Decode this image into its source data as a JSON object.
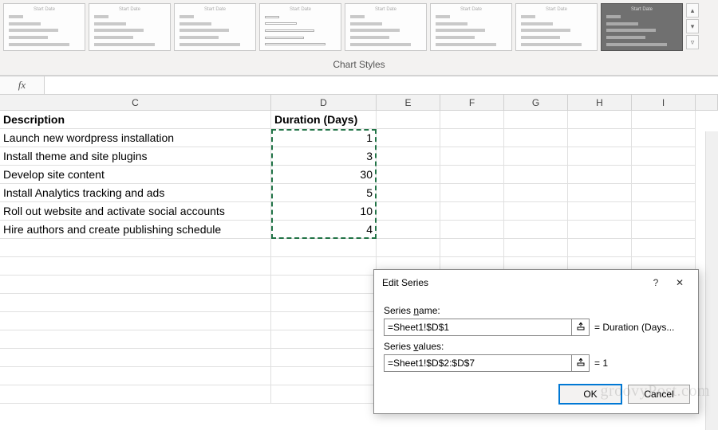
{
  "ribbon": {
    "label": "Chart Styles",
    "thumb_title": "Start Date"
  },
  "formula_bar": {
    "fx": "fx",
    "value": ""
  },
  "columns": [
    "C",
    "D",
    "E",
    "F",
    "G",
    "H",
    "I"
  ],
  "headers": {
    "c": "Description",
    "d": "Duration (Days)"
  },
  "rows": [
    {
      "desc": "Launch new wordpress installation",
      "dur": "1"
    },
    {
      "desc": "Install theme and site plugins",
      "dur": "3"
    },
    {
      "desc": "Develop site content",
      "dur": "30"
    },
    {
      "desc": "Install Analytics tracking and ads",
      "dur": "5"
    },
    {
      "desc": "Roll out website and activate social accounts",
      "dur": "10"
    },
    {
      "desc": "Hire authors and create publishing schedule",
      "dur": "4"
    }
  ],
  "dialog": {
    "title": "Edit Series",
    "name_label_pre": "Series ",
    "name_label_u": "n",
    "name_label_post": "ame:",
    "name_value": "=Sheet1!$D$1",
    "name_eq": "= Duration (Days...",
    "values_label_pre": "Series ",
    "values_label_u": "v",
    "values_label_post": "alues:",
    "values_value": "=Sheet1!$D$2:$D$7",
    "values_eq": "= 1",
    "ok": "OK",
    "cancel": "Cancel",
    "help": "?",
    "close": "✕"
  },
  "watermark": "groovyPost.com",
  "chart_data": {
    "type": "bar",
    "title": "Duration (Days)",
    "xlabel": "Duration (Days)",
    "ylabel": "Description",
    "categories": [
      "Launch new wordpress installation",
      "Install theme and site plugins",
      "Develop site content",
      "Install Analytics tracking and ads",
      "Roll out website and activate social accounts",
      "Hire authors and create publishing schedule"
    ],
    "values": [
      1,
      3,
      30,
      5,
      10,
      4
    ]
  }
}
